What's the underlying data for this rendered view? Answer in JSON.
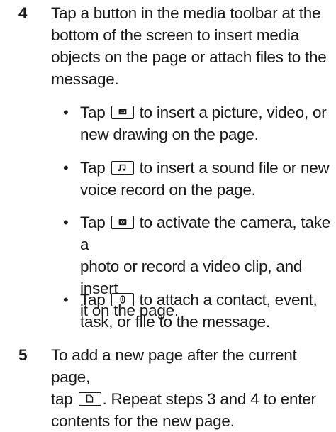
{
  "step4": {
    "number": "4",
    "lines": [
      "Tap a button in the media toolbar at the",
      "bottom of the screen to insert media",
      "objects on the page or attach files to the",
      "message."
    ]
  },
  "bullets": [
    {
      "symbol": "•",
      "icon": "picture-icon",
      "first_pre": "Tap",
      "first_post": "to insert a picture, video, or",
      "rest": [
        "new drawing on the page."
      ]
    },
    {
      "symbol": "•",
      "icon": "sound-icon",
      "first_pre": "Tap",
      "first_post": "to insert a sound file or new",
      "rest": [
        "voice record on the page."
      ]
    },
    {
      "symbol": "•",
      "icon": "camera-icon",
      "first_pre": "Tap",
      "first_post": "to activate the camera, take a",
      "rest": [
        "photo or record a video clip, and insert",
        "it on the page."
      ]
    },
    {
      "symbol": "•",
      "icon": "attach-icon",
      "first_pre": "Tap",
      "first_post": "to attach a contact, event,",
      "rest": [
        "task, or file to the message."
      ]
    }
  ],
  "step5": {
    "number": "5",
    "line1": "To add a new page after the current page,",
    "line2_pre": "tap",
    "line2_post": ". Repeat steps 3 and 4 to enter",
    "line3": "contents for the new page.",
    "icon": "new-page-icon"
  }
}
